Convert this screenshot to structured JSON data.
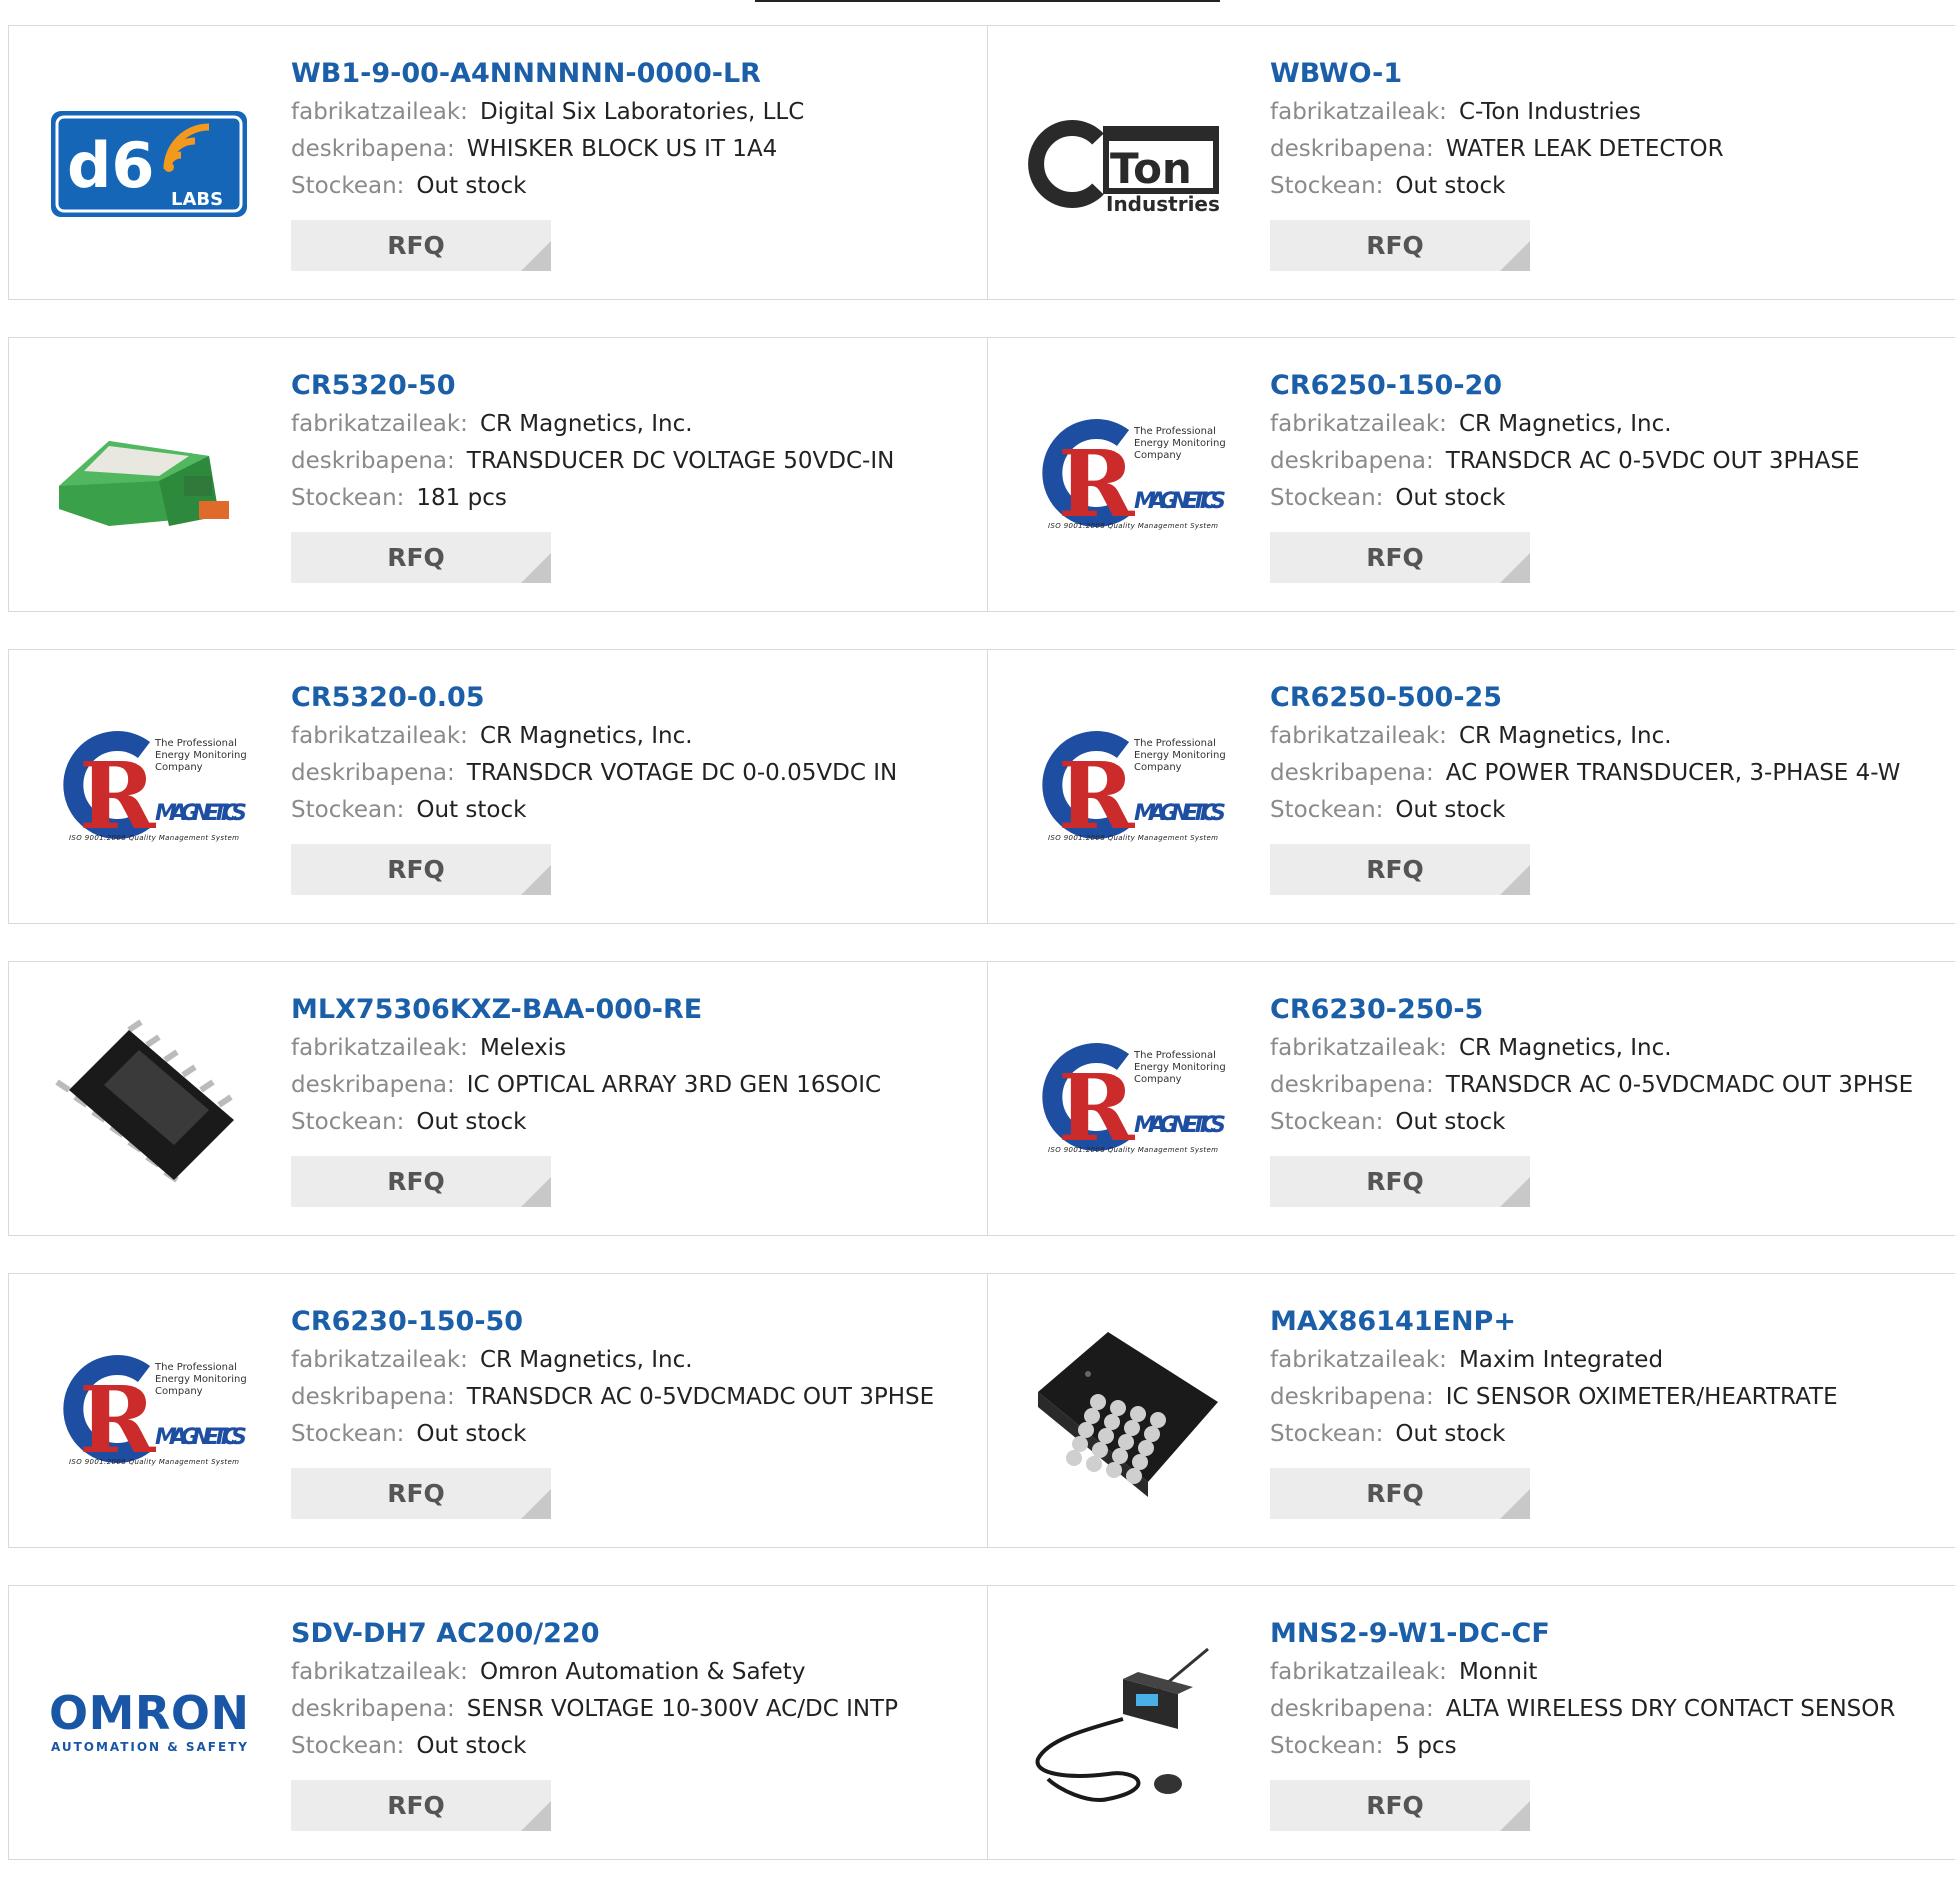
{
  "labels": {
    "manufacturer": "fabrikatzaileak:",
    "description": "deskribapena:",
    "stock": "Stockean:",
    "rfq": "RFQ"
  },
  "brand_colors": {
    "link": "#1a5fa8",
    "cr_red": "#cc2b2b",
    "cr_blue": "#1d4ea2",
    "d6_blue": "#1666b8",
    "omron_blue": "#1a56a6"
  },
  "products": [
    {
      "part": "WB1-9-00-A4NNNNNN-0000-LR",
      "manufacturer": "Digital Six Laboratories, LLC",
      "description": "WHISKER BLOCK US IT 1A4",
      "stock": "Out stock",
      "logo": "d6-labs-logo"
    },
    {
      "part": "WBWO-1",
      "manufacturer": "C-Ton Industries",
      "description": "WATER LEAK DETECTOR",
      "stock": "Out stock",
      "logo": "c-ton-logo"
    },
    {
      "part": "CR5320-50",
      "manufacturer": "CR Magnetics, Inc.",
      "description": "TRANSDUCER DC VOLTAGE 50VDC-IN",
      "stock": "181 pcs",
      "logo": "transducer-module-image"
    },
    {
      "part": "CR6250-150-20",
      "manufacturer": "CR Magnetics, Inc.",
      "description": "TRANSDCR AC 0-5VDC OUT 3PHASE",
      "stock": "Out stock",
      "logo": "cr-magnetics-logo"
    },
    {
      "part": "CR5320-0.05",
      "manufacturer": "CR Magnetics, Inc.",
      "description": "TRANSDCR VOTAGE DC 0-0.05VDC IN",
      "stock": "Out stock",
      "logo": "cr-magnetics-logo"
    },
    {
      "part": "CR6250-500-25",
      "manufacturer": "CR Magnetics, Inc.",
      "description": "AC POWER TRANSDUCER, 3-PHASE 4-W",
      "stock": "Out stock",
      "logo": "cr-magnetics-logo"
    },
    {
      "part": "MLX75306KXZ-BAA-000-RE",
      "manufacturer": "Melexis",
      "description": "IC OPTICAL ARRAY 3RD GEN 16SOIC",
      "stock": "Out stock",
      "logo": "soic-chip-image"
    },
    {
      "part": "CR6230-250-5",
      "manufacturer": "CR Magnetics, Inc.",
      "description": "TRANSDCR AC 0-5VDCMADC OUT 3PHSE",
      "stock": "Out stock",
      "logo": "cr-magnetics-logo"
    },
    {
      "part": "CR6230-150-50",
      "manufacturer": "CR Magnetics, Inc.",
      "description": "TRANSDCR AC 0-5VDCMADC OUT 3PHSE",
      "stock": "Out stock",
      "logo": "cr-magnetics-logo"
    },
    {
      "part": "MAX86141ENP+",
      "manufacturer": "Maxim Integrated",
      "description": "IC SENSOR OXIMETER/HEARTRATE",
      "stock": "Out stock",
      "logo": "bga-chip-image"
    },
    {
      "part": "SDV-DH7 AC200/220",
      "manufacturer": "Omron Automation & Safety",
      "description": "SENSR VOLTAGE 10-300V AC/DC INTP",
      "stock": "Out stock",
      "logo": "omron-logo"
    },
    {
      "part": "MNS2-9-W1-DC-CF",
      "manufacturer": "Monnit",
      "description": "ALTA WIRELESS DRY CONTACT SENSOR",
      "stock": "5 pcs",
      "logo": "wireless-sensor-image"
    }
  ],
  "logo_text": {
    "d6_main": "d6",
    "d6_sub": "LABS",
    "cton_main": "Ton",
    "cton_sub": "Industries",
    "cr_tagline_1": "The Professional",
    "cr_tagline_2": "Energy Monitoring",
    "cr_tagline_3": "Company",
    "cr_brand": "MAGNETICS",
    "cr_iso": "ISO 9001:2008 Quality Management System",
    "omron_main": "OMRON",
    "omron_sub": "AUTOMATION & SAFETY"
  }
}
